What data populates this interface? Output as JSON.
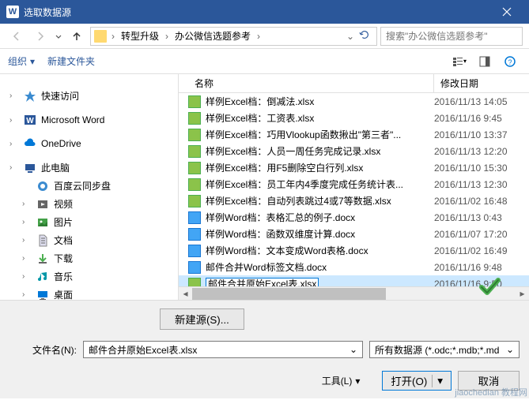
{
  "titlebar": {
    "app_icon": "W",
    "title": "选取数据源"
  },
  "nav": {
    "breadcrumb": [
      "转型升级",
      "办公微信选题参考"
    ],
    "search_placeholder": "搜索\"办公微信选题参考\""
  },
  "toolbar": {
    "organize": "组织",
    "new_folder": "新建文件夹"
  },
  "sidebar": {
    "items": [
      {
        "icon": "star",
        "label": "快速访问",
        "color": "#3b8bd0",
        "expandable": true
      },
      {
        "icon": "word",
        "label": "Microsoft Word",
        "color": "#2b579a",
        "expandable": true
      },
      {
        "icon": "cloud",
        "label": "OneDrive",
        "color": "#0078d7",
        "expandable": true
      },
      {
        "icon": "pc",
        "label": "此电脑",
        "color": "#2b579a",
        "expandable": true
      },
      {
        "icon": "baidu",
        "label": "百度云同步盘",
        "color": "#3b8bd0",
        "expandable": false,
        "indent": true
      },
      {
        "icon": "video",
        "label": "视频",
        "color": "#666",
        "expandable": true,
        "indent": true
      },
      {
        "icon": "picture",
        "label": "图片",
        "color": "#43a047",
        "expandable": true,
        "indent": true
      },
      {
        "icon": "document",
        "label": "文档",
        "color": "#666",
        "expandable": true,
        "indent": true
      },
      {
        "icon": "download",
        "label": "下载",
        "color": "#666",
        "expandable": true,
        "indent": true
      },
      {
        "icon": "music",
        "label": "音乐",
        "color": "#0097a7",
        "expandable": true,
        "indent": true
      },
      {
        "icon": "desktop",
        "label": "桌面",
        "color": "#0078d7",
        "expandable": true,
        "indent": true
      }
    ]
  },
  "file_list": {
    "columns": {
      "name": "名称",
      "date": "修改日期"
    },
    "files": [
      {
        "type": "excel",
        "name": "样例Excel档：倒减法.xlsx",
        "date": "2016/11/13 14:05"
      },
      {
        "type": "excel",
        "name": "样例Excel档：工资表.xlsx",
        "date": "2016/11/16 9:45"
      },
      {
        "type": "excel",
        "name": "样例Excel档：巧用Vlookup函数揪出\"第三者\"...",
        "date": "2016/11/10 13:37"
      },
      {
        "type": "excel",
        "name": "样例Excel档：人员一周任务完成记录.xlsx",
        "date": "2016/11/13 12:20"
      },
      {
        "type": "excel",
        "name": "样例Excel档：用F5删除空白行列.xlsx",
        "date": "2016/11/10 15:30"
      },
      {
        "type": "excel",
        "name": "样例Excel档：员工年内4季度完成任务统计表...",
        "date": "2016/11/13 12:30"
      },
      {
        "type": "excel",
        "name": "样例Excel档：自动列表跳过4或7等数据.xlsx",
        "date": "2016/11/02 16:48"
      },
      {
        "type": "word",
        "name": "样例Word档：表格汇总的例子.docx",
        "date": "2016/11/13 0:43"
      },
      {
        "type": "word",
        "name": "样例Word档：函数双维度计算.docx",
        "date": "2016/11/07 17:20"
      },
      {
        "type": "word",
        "name": "样例Word档：文本变成Word表格.docx",
        "date": "2016/11/02 16:49"
      },
      {
        "type": "word",
        "name": "邮件合并Word标签文档.docx",
        "date": "2016/11/16 9:48"
      },
      {
        "type": "excel",
        "name": "邮件合并原始Excel表.xlsx",
        "date": "2016/11/16 9:50",
        "editing": true
      }
    ]
  },
  "bottom": {
    "new_source": "新建源(S)...",
    "filename_label": "文件名(N):",
    "filename_value": "邮件合并原始Excel表.xlsx",
    "filetype": "所有数据源 (*.odc;*.mdb;*.md",
    "tools": "工具(L)",
    "open": "打开(O)",
    "cancel": "取消"
  },
  "watermark": "jiaochedian 教程网"
}
